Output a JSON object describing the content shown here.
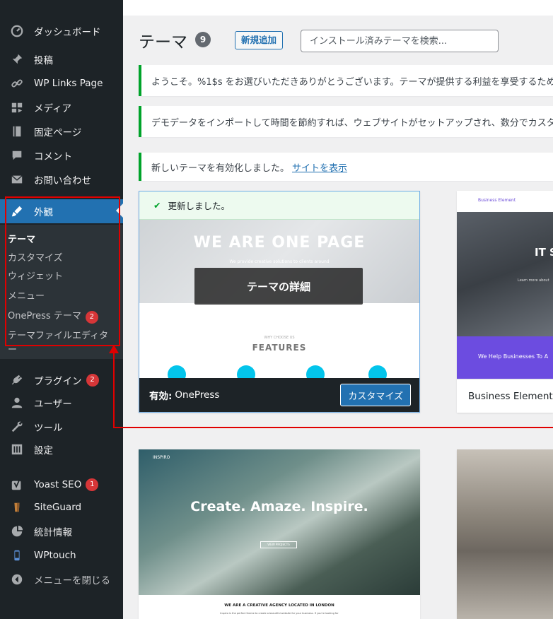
{
  "sidebar": {
    "items": [
      {
        "label": "ダッシュボード",
        "icon": "dashboard-icon",
        "badge": ""
      },
      {
        "label": "投稿",
        "icon": "pin-icon",
        "badge": ""
      },
      {
        "label": "WP Links Page",
        "icon": "link-icon",
        "badge": ""
      },
      {
        "label": "メディア",
        "icon": "media-icon",
        "badge": ""
      },
      {
        "label": "固定ページ",
        "icon": "page-icon",
        "badge": ""
      },
      {
        "label": "コメント",
        "icon": "comment-icon",
        "badge": ""
      },
      {
        "label": "お問い合わせ",
        "icon": "mail-icon",
        "badge": ""
      },
      {
        "label": "外観",
        "icon": "appearance-icon",
        "badge": ""
      },
      {
        "label": "プラグイン",
        "icon": "plugin-icon",
        "badge": "2"
      },
      {
        "label": "ユーザー",
        "icon": "user-icon",
        "badge": ""
      },
      {
        "label": "ツール",
        "icon": "wrench-icon",
        "badge": ""
      },
      {
        "label": "設定",
        "icon": "settings-icon",
        "badge": ""
      },
      {
        "label": "Yoast SEO",
        "icon": "yoast-icon",
        "badge": "1"
      },
      {
        "label": "SiteGuard",
        "icon": "siteguard-icon",
        "badge": ""
      },
      {
        "label": "統計情報",
        "icon": "stats-icon",
        "badge": ""
      },
      {
        "label": "WPtouch",
        "icon": "phone-icon",
        "badge": ""
      },
      {
        "label": "メニューを閉じる",
        "icon": "collapse-icon",
        "badge": ""
      }
    ],
    "submenu": [
      {
        "label": "テーマ"
      },
      {
        "label": "カスタマイズ"
      },
      {
        "label": "ウィジェット"
      },
      {
        "label": "メニュー"
      },
      {
        "label": "OnePress テーマ",
        "badge": "2"
      },
      {
        "label": "テーマファイルエディター"
      }
    ]
  },
  "header": {
    "title": "テーマ",
    "count": "9",
    "add_new": "新規追加",
    "search_placeholder": "インストール済みテーマを検索..."
  },
  "notices": [
    "ようこそ。%1$s をお選びいただきありがとうございます。テーマが提供する利益を享受するため",
    "デモデータをインポートして時間を節約すれば、ウェブサイトがセットアップされ、数分でカスタ",
    "新しいテーマを有効化しました。"
  ],
  "notice_link": "サイトを表示",
  "active_theme": {
    "updated": "更新しました。",
    "headline": "WE ARE ONE PAGE",
    "tagline": "We provide creative solutions to clients around",
    "details": "テーマの詳細",
    "features": "FEATURES",
    "features_small": "WHY CHOOSE US",
    "active_label": "有効:",
    "name": "OnePress",
    "customize": "カスタマイズ"
  },
  "theme2": {
    "brand": "Business Element",
    "headline": "IT S",
    "sub": "Learn more about",
    "banner": "We Help Businesses To A",
    "name": "Business Element"
  },
  "theme3": {
    "brand": "INSPIRO",
    "headline": "Create. Amaze. Inspire.",
    "cta": "VIEW PROJECTS",
    "below": "WE ARE A CREATIVE AGENCY LOCATED IN LONDON",
    "below_small": "Inspiro is the perfect theme to create a beautiful website for your business. If you're looking for"
  }
}
